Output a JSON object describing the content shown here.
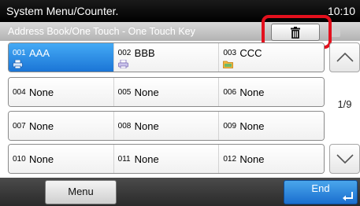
{
  "header": {
    "title": "System Menu/Counter.",
    "time": "10:10"
  },
  "subheader": {
    "title": "Address Book/One Touch - One Touch Key",
    "delete_icon": "trash-icon"
  },
  "keys": [
    [
      {
        "number": "001",
        "name": "AAA",
        "icon": "printer-icon",
        "selected": true
      },
      {
        "number": "002",
        "name": "BBB",
        "icon": "printer-icon",
        "selected": false
      },
      {
        "number": "003",
        "name": "CCC",
        "icon": "folder-icon",
        "selected": false
      }
    ],
    [
      {
        "number": "004",
        "name": "None"
      },
      {
        "number": "005",
        "name": "None"
      },
      {
        "number": "006",
        "name": "None"
      }
    ],
    [
      {
        "number": "007",
        "name": "None"
      },
      {
        "number": "008",
        "name": "None"
      },
      {
        "number": "009",
        "name": "None"
      }
    ],
    [
      {
        "number": "010",
        "name": "None"
      },
      {
        "number": "011",
        "name": "None"
      },
      {
        "number": "012",
        "name": "None"
      }
    ]
  ],
  "pager": {
    "page": "1/9",
    "up_icon": "chevron-up-icon",
    "down_icon": "chevron-down-icon"
  },
  "footer": {
    "menu_label": "Menu",
    "end_label": "End",
    "enter_icon": "enter-icon"
  },
  "colors": {
    "highlight": "#e3101d",
    "selected": "#2a8ae6",
    "end_button": "#1a6ecf"
  }
}
